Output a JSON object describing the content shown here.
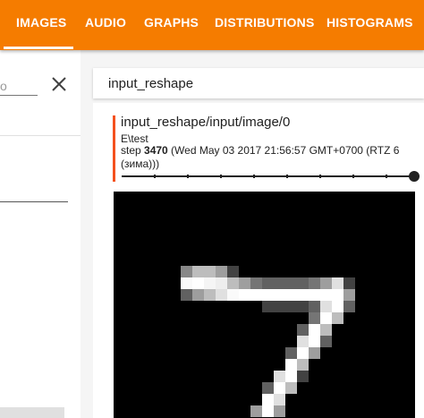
{
  "tabs": [
    {
      "label": "IMAGES",
      "active": true
    },
    {
      "label": "AUDIO",
      "active": false
    },
    {
      "label": "GRAPHS",
      "active": false
    },
    {
      "label": "DISTRIBUTIONS",
      "active": false
    },
    {
      "label": "HISTOGRAMS",
      "active": false
    }
  ],
  "colors": {
    "accent": "#f57c00",
    "card_marker": "#f4511e"
  },
  "sidebar": {
    "filter_partial_text": "o",
    "clear_icon": "close-icon"
  },
  "search": {
    "value": "input_reshape"
  },
  "card": {
    "tag": "input_reshape/input/image/0",
    "run": "E\\test",
    "step_prefix": "step ",
    "step_value": "3470",
    "step_time": " (Wed May 03 2017 21:56:57 GMT+0700 (RTZ 6 (зима)))"
  },
  "image": {
    "description_icon": "mnist-digit-image"
  }
}
